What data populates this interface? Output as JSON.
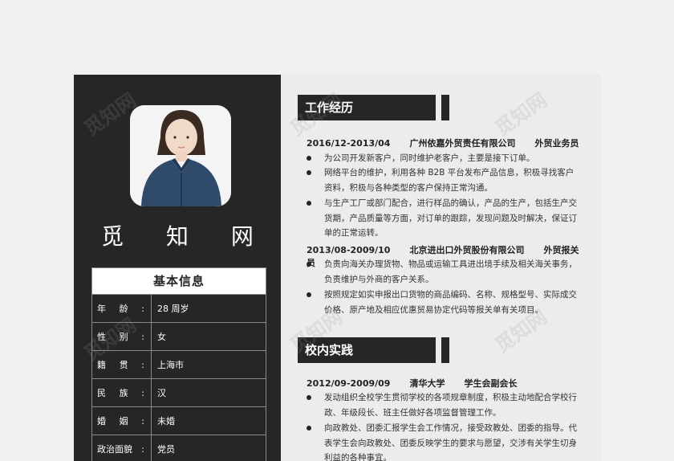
{
  "profile": {
    "name": "觅 知 网"
  },
  "basic_info": {
    "title": "基本信息",
    "rows": [
      {
        "label_a": "年",
        "label_b": "龄",
        "colon": ":",
        "value": "28 周岁"
      },
      {
        "label_a": "性",
        "label_b": "别",
        "colon": ":",
        "value": "女"
      },
      {
        "label_a": "籍",
        "label_b": "贯",
        "colon": ":",
        "value": "上海市"
      },
      {
        "label_a": "民",
        "label_b": "族",
        "colon": ":",
        "value": "汉"
      },
      {
        "label_a": "婚",
        "label_b": "姻",
        "colon": ":",
        "value": "未婚"
      },
      {
        "label_a": "政治面貌",
        "label_b": "",
        "colon": ":",
        "value": "党员"
      }
    ]
  },
  "work": {
    "title": "工作经历",
    "entries": [
      {
        "period": "2016/12-2013/04",
        "company": "广州依嘉外贸责任有限公司",
        "role": "外贸业务员",
        "bullets": [
          "为公司开发新客户，同时维护老客户，主要是接下订单。",
          "网络平台的维护，利用各种 B2B 平台发布产品信息，积极寻找客户资料，积极与各种类型的客户保持正常沟通。",
          "与生产工厂或部门配合，进行样品的确认，产品的生产，包括生产交货期，产品质量等方面，对订单的跟踪，发现问题及时解决，保证订单的正常运转。"
        ]
      },
      {
        "period": "2013/08-2009/10",
        "company": "北京进出口外贸股份有限公司",
        "role": "外贸报关员",
        "bullets": [
          "负责向海关办理货物、物品或运输工具进出境手续及相关海关事务，负责维护与外商的客户关系。",
          "按照规定如实申报出口货物的商品编码、名称、规格型号、实际成交价格、原产地及相应优惠贸易协定代码等报关单有关项目。"
        ]
      }
    ]
  },
  "school": {
    "title": "校内实践",
    "entries": [
      {
        "period": "2012/09-2009/09",
        "company": "清华大学",
        "role": "学生会副会长",
        "bullets": [
          "发动组织全校学生贯彻学校的各项规章制度，积极主动地配合学校行政、年级段长、班主任做好各项监督管理工作。",
          "向政教处、团委汇报学生会工作情况，接受政教处、团委的指导。代表学生会向政教处、团委反映学生的要求与愿望，交涉有关学生切身利益的各种事宜。"
        ]
      }
    ]
  },
  "watermark": "觅知网"
}
